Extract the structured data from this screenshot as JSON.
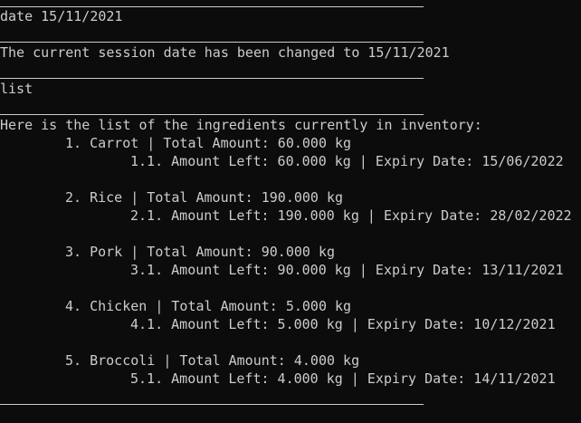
{
  "session": {
    "command_date": "date 15/11/2021",
    "response_date": "The current session date has been changed to 15/11/2021",
    "command_list": "list",
    "list_intro": "Here is the list of the ingredients currently in inventory:"
  },
  "ingredients": [
    {
      "header": "1. Carrot | Total Amount: 60.000 kg",
      "batch": "1.1. Amount Left: 60.000 kg | Expiry Date: 15/06/2022"
    },
    {
      "header": "2. Rice | Total Amount: 190.000 kg",
      "batch": "2.1. Amount Left: 190.000 kg | Expiry Date: 28/02/2022"
    },
    {
      "header": "3. Pork | Total Amount: 90.000 kg",
      "batch": "3.1. Amount Left: 90.000 kg | Expiry Date: 13/11/2021"
    },
    {
      "header": "4. Chicken | Total Amount: 5.000 kg",
      "batch": "4.1. Amount Left: 5.000 kg | Expiry Date: 10/12/2021"
    },
    {
      "header": "5. Broccoli | Total Amount: 4.000 kg",
      "batch": "5.1. Amount Left: 4.000 kg | Expiry Date: 14/11/2021"
    }
  ]
}
